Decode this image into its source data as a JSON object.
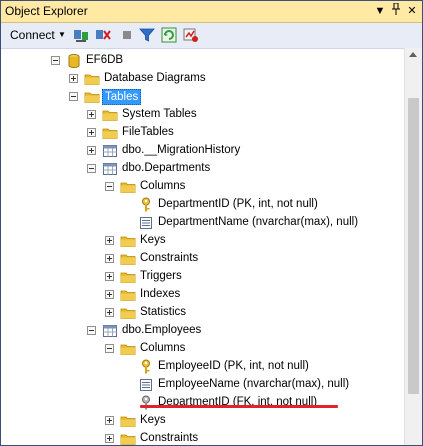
{
  "window": {
    "title": "Object Explorer",
    "pin_glyph": "▾ ⊕ ✕"
  },
  "toolbar": {
    "connect_label": "Connect",
    "icons": [
      "connect-object-icon",
      "disconnect-icon",
      "stop-icon",
      "filter-icon",
      "refresh-icon",
      "activity-monitor-icon"
    ]
  },
  "tree": [
    {
      "label": "EF6DB",
      "icon": "database-icon",
      "expander": "minus",
      "depth": 2
    },
    {
      "label": "Database Diagrams",
      "icon": "folder-icon",
      "expander": "plus",
      "depth": 3
    },
    {
      "label": "Tables",
      "icon": "folder-icon",
      "expander": "minus",
      "depth": 3,
      "selected": true
    },
    {
      "label": "System Tables",
      "icon": "folder-icon",
      "expander": "plus",
      "depth": 4
    },
    {
      "label": "FileTables",
      "icon": "folder-icon",
      "expander": "plus",
      "depth": 4
    },
    {
      "label": "dbo.__MigrationHistory",
      "icon": "table-icon",
      "expander": "plus",
      "depth": 4
    },
    {
      "label": "dbo.Departments",
      "icon": "table-icon",
      "expander": "minus",
      "depth": 4
    },
    {
      "label": "Columns",
      "icon": "folder-icon",
      "expander": "minus",
      "depth": 5
    },
    {
      "label": "DepartmentID (PK, int, not null)",
      "icon": "primary-key-icon",
      "expander": "none",
      "depth": 6
    },
    {
      "label": "DepartmentName (nvarchar(max), null)",
      "icon": "column-icon",
      "expander": "none",
      "depth": 6
    },
    {
      "label": "Keys",
      "icon": "folder-icon",
      "expander": "plus",
      "depth": 5
    },
    {
      "label": "Constraints",
      "icon": "folder-icon",
      "expander": "plus",
      "depth": 5
    },
    {
      "label": "Triggers",
      "icon": "folder-icon",
      "expander": "plus",
      "depth": 5
    },
    {
      "label": "Indexes",
      "icon": "folder-icon",
      "expander": "plus",
      "depth": 5
    },
    {
      "label": "Statistics",
      "icon": "folder-icon",
      "expander": "plus",
      "depth": 5
    },
    {
      "label": "dbo.Employees",
      "icon": "table-icon",
      "expander": "minus",
      "depth": 4
    },
    {
      "label": "Columns",
      "icon": "folder-icon",
      "expander": "minus",
      "depth": 5
    },
    {
      "label": "EmployeeID (PK, int, not null)",
      "icon": "primary-key-icon",
      "expander": "none",
      "depth": 6
    },
    {
      "label": "EmployeeName (nvarchar(max), null)",
      "icon": "column-icon",
      "expander": "none",
      "depth": 6
    },
    {
      "label": "DepartmentID (FK, int, not null)",
      "icon": "foreign-key-icon",
      "expander": "none",
      "depth": 6,
      "highlighted": true
    },
    {
      "label": "Keys",
      "icon": "folder-icon",
      "expander": "plus",
      "depth": 5
    },
    {
      "label": "Constraints",
      "icon": "folder-icon",
      "expander": "plus",
      "depth": 5
    }
  ],
  "colors": {
    "title_bar": "#ffe9a3",
    "toolbar": "#e7ecf6",
    "selection": "#3399ff",
    "highlight_underline": "#e0242a",
    "folder": "#e8b923",
    "key": "#d9a21b"
  }
}
